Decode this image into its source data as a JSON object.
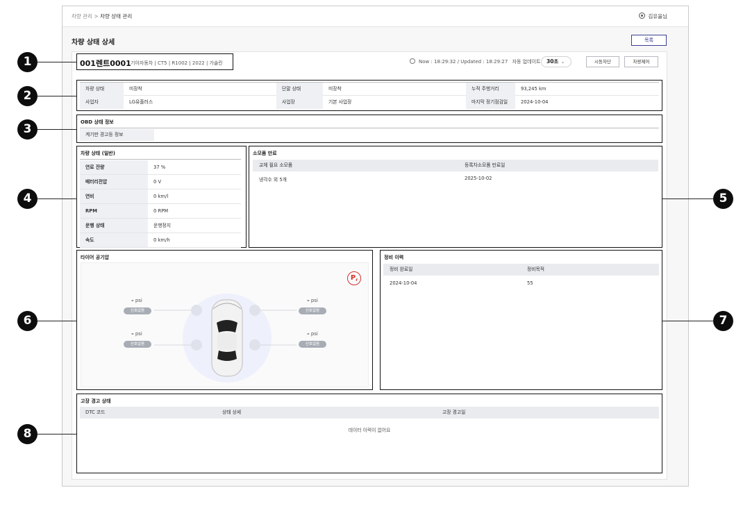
{
  "breadcrumb": {
    "parent": "차량 관리",
    "separator": ">",
    "current": "차량 상태 관리"
  },
  "user": {
    "name": "김유을님",
    "icon": "user-circle-icon"
  },
  "page": {
    "title": "차량 상태 상세",
    "list_button": "목록"
  },
  "vehicle": {
    "id": "001렌트0001",
    "info": "기아자동차 | CT5 | R1002 | 2022 | 가솔린",
    "time_text": "Now : 18:29:32 / Updated : 18:29:27",
    "auto_update_label": "자동 업데이트",
    "interval": "30초",
    "buttons": {
      "remote_stop": "시동차단",
      "vehicle_control": "차량제어"
    }
  },
  "summary": {
    "rows": [
      [
        {
          "label": "차량 상태",
          "value": "미장착"
        },
        {
          "label": "단말 상태",
          "value": "미장착"
        },
        {
          "label": "누적 주행거리",
          "value": "93,245 km"
        }
      ],
      [
        {
          "label": "사업자",
          "value": "LG유플러스"
        },
        {
          "label": "사업장",
          "value": "기본 사업장"
        },
        {
          "label": "마지막 정기점검일",
          "value": "2024-10-04"
        }
      ]
    ]
  },
  "obd": {
    "title": "OBD 상태 정보",
    "label": "계기판 경고등 정보",
    "value": ""
  },
  "general": {
    "title": "차량 상태 (일반)",
    "rows": [
      {
        "label": "연료 잔량",
        "value": "37 %"
      },
      {
        "label": "배터리전압",
        "value": "0 V"
      },
      {
        "label": "연비",
        "value": "0 km/l"
      },
      {
        "label": "RPM",
        "value": "0 RPM"
      },
      {
        "label": "운행 상태",
        "value": "운행정지"
      },
      {
        "label": "속도",
        "value": "0 km/h"
      }
    ]
  },
  "consumables": {
    "title": "소모품 만료",
    "headers": [
      "교체 필요 소모품",
      "등록차소모품 만료일"
    ],
    "rows": [
      [
        "냉각수 외 5개",
        "2025-10-02"
      ]
    ]
  },
  "tire": {
    "title": "타이어 공기압",
    "parking_badge": "P",
    "parking_badge_sub": "r",
    "tires": [
      {
        "value": "–",
        "unit": "psi",
        "status": "신호없음"
      },
      {
        "value": "–",
        "unit": "psi",
        "status": "신호없음"
      },
      {
        "value": "–",
        "unit": "psi",
        "status": "신호없음"
      },
      {
        "value": "–",
        "unit": "psi",
        "status": "신호없음"
      }
    ]
  },
  "maintenance": {
    "title": "정비 이력",
    "headers": [
      "정비 완료일",
      "정비목적"
    ],
    "rows": [
      [
        "2024-10-04",
        "55"
      ]
    ]
  },
  "dtc": {
    "title": "고장 경고 상태",
    "headers": [
      "DTC 코드",
      "상태 상세",
      "고장 경고일"
    ],
    "empty": "데이터 이력이 없어요"
  },
  "callouts": [
    "1",
    "2",
    "3",
    "4",
    "5",
    "6",
    "7",
    "8"
  ]
}
